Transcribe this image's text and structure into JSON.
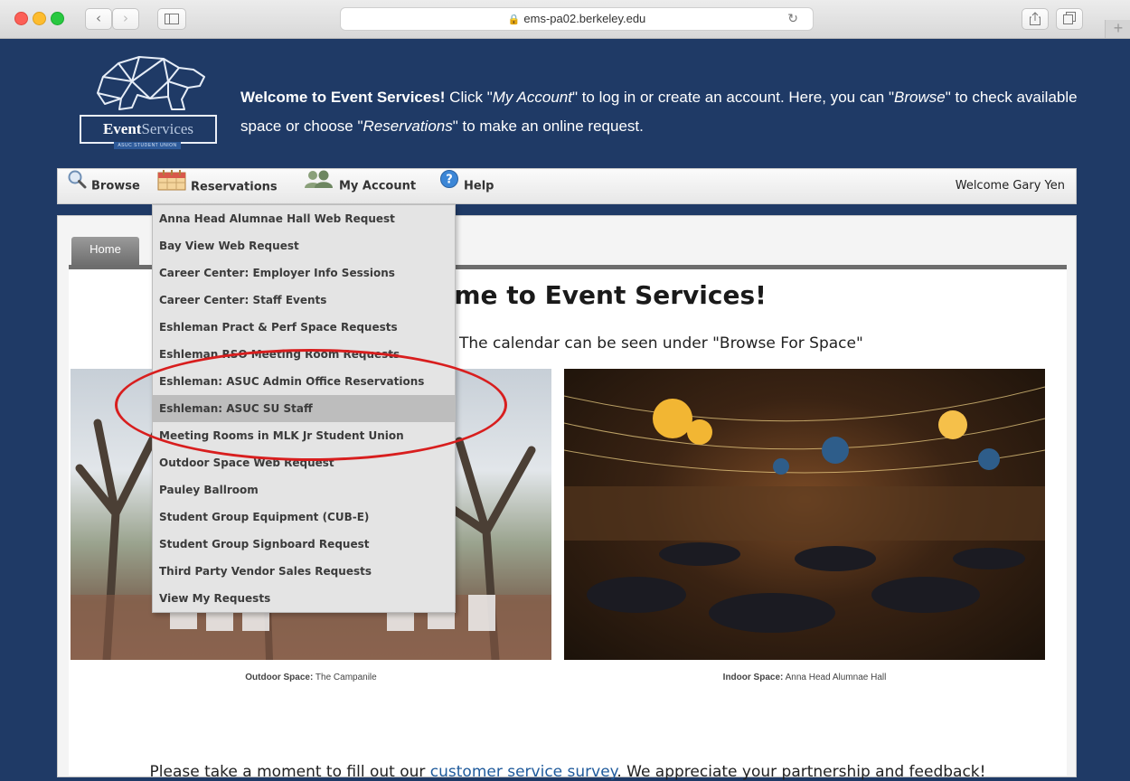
{
  "browser": {
    "url": "ems-pa02.berkeley.edu",
    "back_icon": "‹",
    "forward_icon": "›"
  },
  "header": {
    "logo_brand_bold": "Event",
    "logo_brand_light": "Services",
    "logo_tagline": "ASUC STUDENT UNION",
    "welcome_bold": "Welcome to Event Services!",
    "welcome_part1": " Click \"",
    "welcome_my_account": "My Account",
    "welcome_part2": "\" to log in or create an account. Here, you can \"",
    "welcome_browse": "Browse",
    "welcome_part3": "\" to check available space or choose \"",
    "welcome_reservations": "Reservations",
    "welcome_part4": "\" to make an online request."
  },
  "nav": {
    "browse": "Browse",
    "reservations": "Reservations",
    "my_account": "My Account",
    "help": "Help",
    "welcome_user": "Welcome Gary Yen"
  },
  "tabs": {
    "home": "Home"
  },
  "main": {
    "title": "me to Event Services!",
    "subtitle": "The calendar can be seen under \"Browse For Space\"",
    "caption_outdoor_label": "Outdoor Space:",
    "caption_outdoor_value": " The Campanile",
    "caption_indoor_label": "Indoor Space:",
    "caption_indoor_value": " Anna Head Alumnae Hall",
    "survey_before": "Please take a moment to fill out our ",
    "survey_link": "customer service survey",
    "survey_after": ". We appreciate your partnership and feedback!"
  },
  "reservations_menu": {
    "items": [
      {
        "label": "Anna Head Alumnae Hall Web Request"
      },
      {
        "label": "Bay View Web Request"
      },
      {
        "label": "Career Center: Employer Info Sessions"
      },
      {
        "label": "Career Center: Staff Events"
      },
      {
        "label": "Eshleman Pract & Perf Space Requests"
      },
      {
        "label": "Eshleman RSO Meeting Room Requests"
      },
      {
        "label": "Eshleman: ASUC Admin Office Reservations"
      },
      {
        "label": "Eshleman: ASUC SU Staff"
      },
      {
        "label": "Meeting Rooms in MLK Jr Student Union"
      },
      {
        "label": "Outdoor Space Web Request"
      },
      {
        "label": "Pauley Ballroom"
      },
      {
        "label": "Student Group Equipment (CUB-E)"
      },
      {
        "label": "Student Group Signboard Request"
      },
      {
        "label": "Third Party Vendor Sales Requests"
      },
      {
        "label": "View My Requests"
      }
    ],
    "hovered_index": 7
  },
  "colors": {
    "page_background": "#1f3a66",
    "link": "#1f5a9b",
    "highlight_ring": "#d81e1e"
  }
}
